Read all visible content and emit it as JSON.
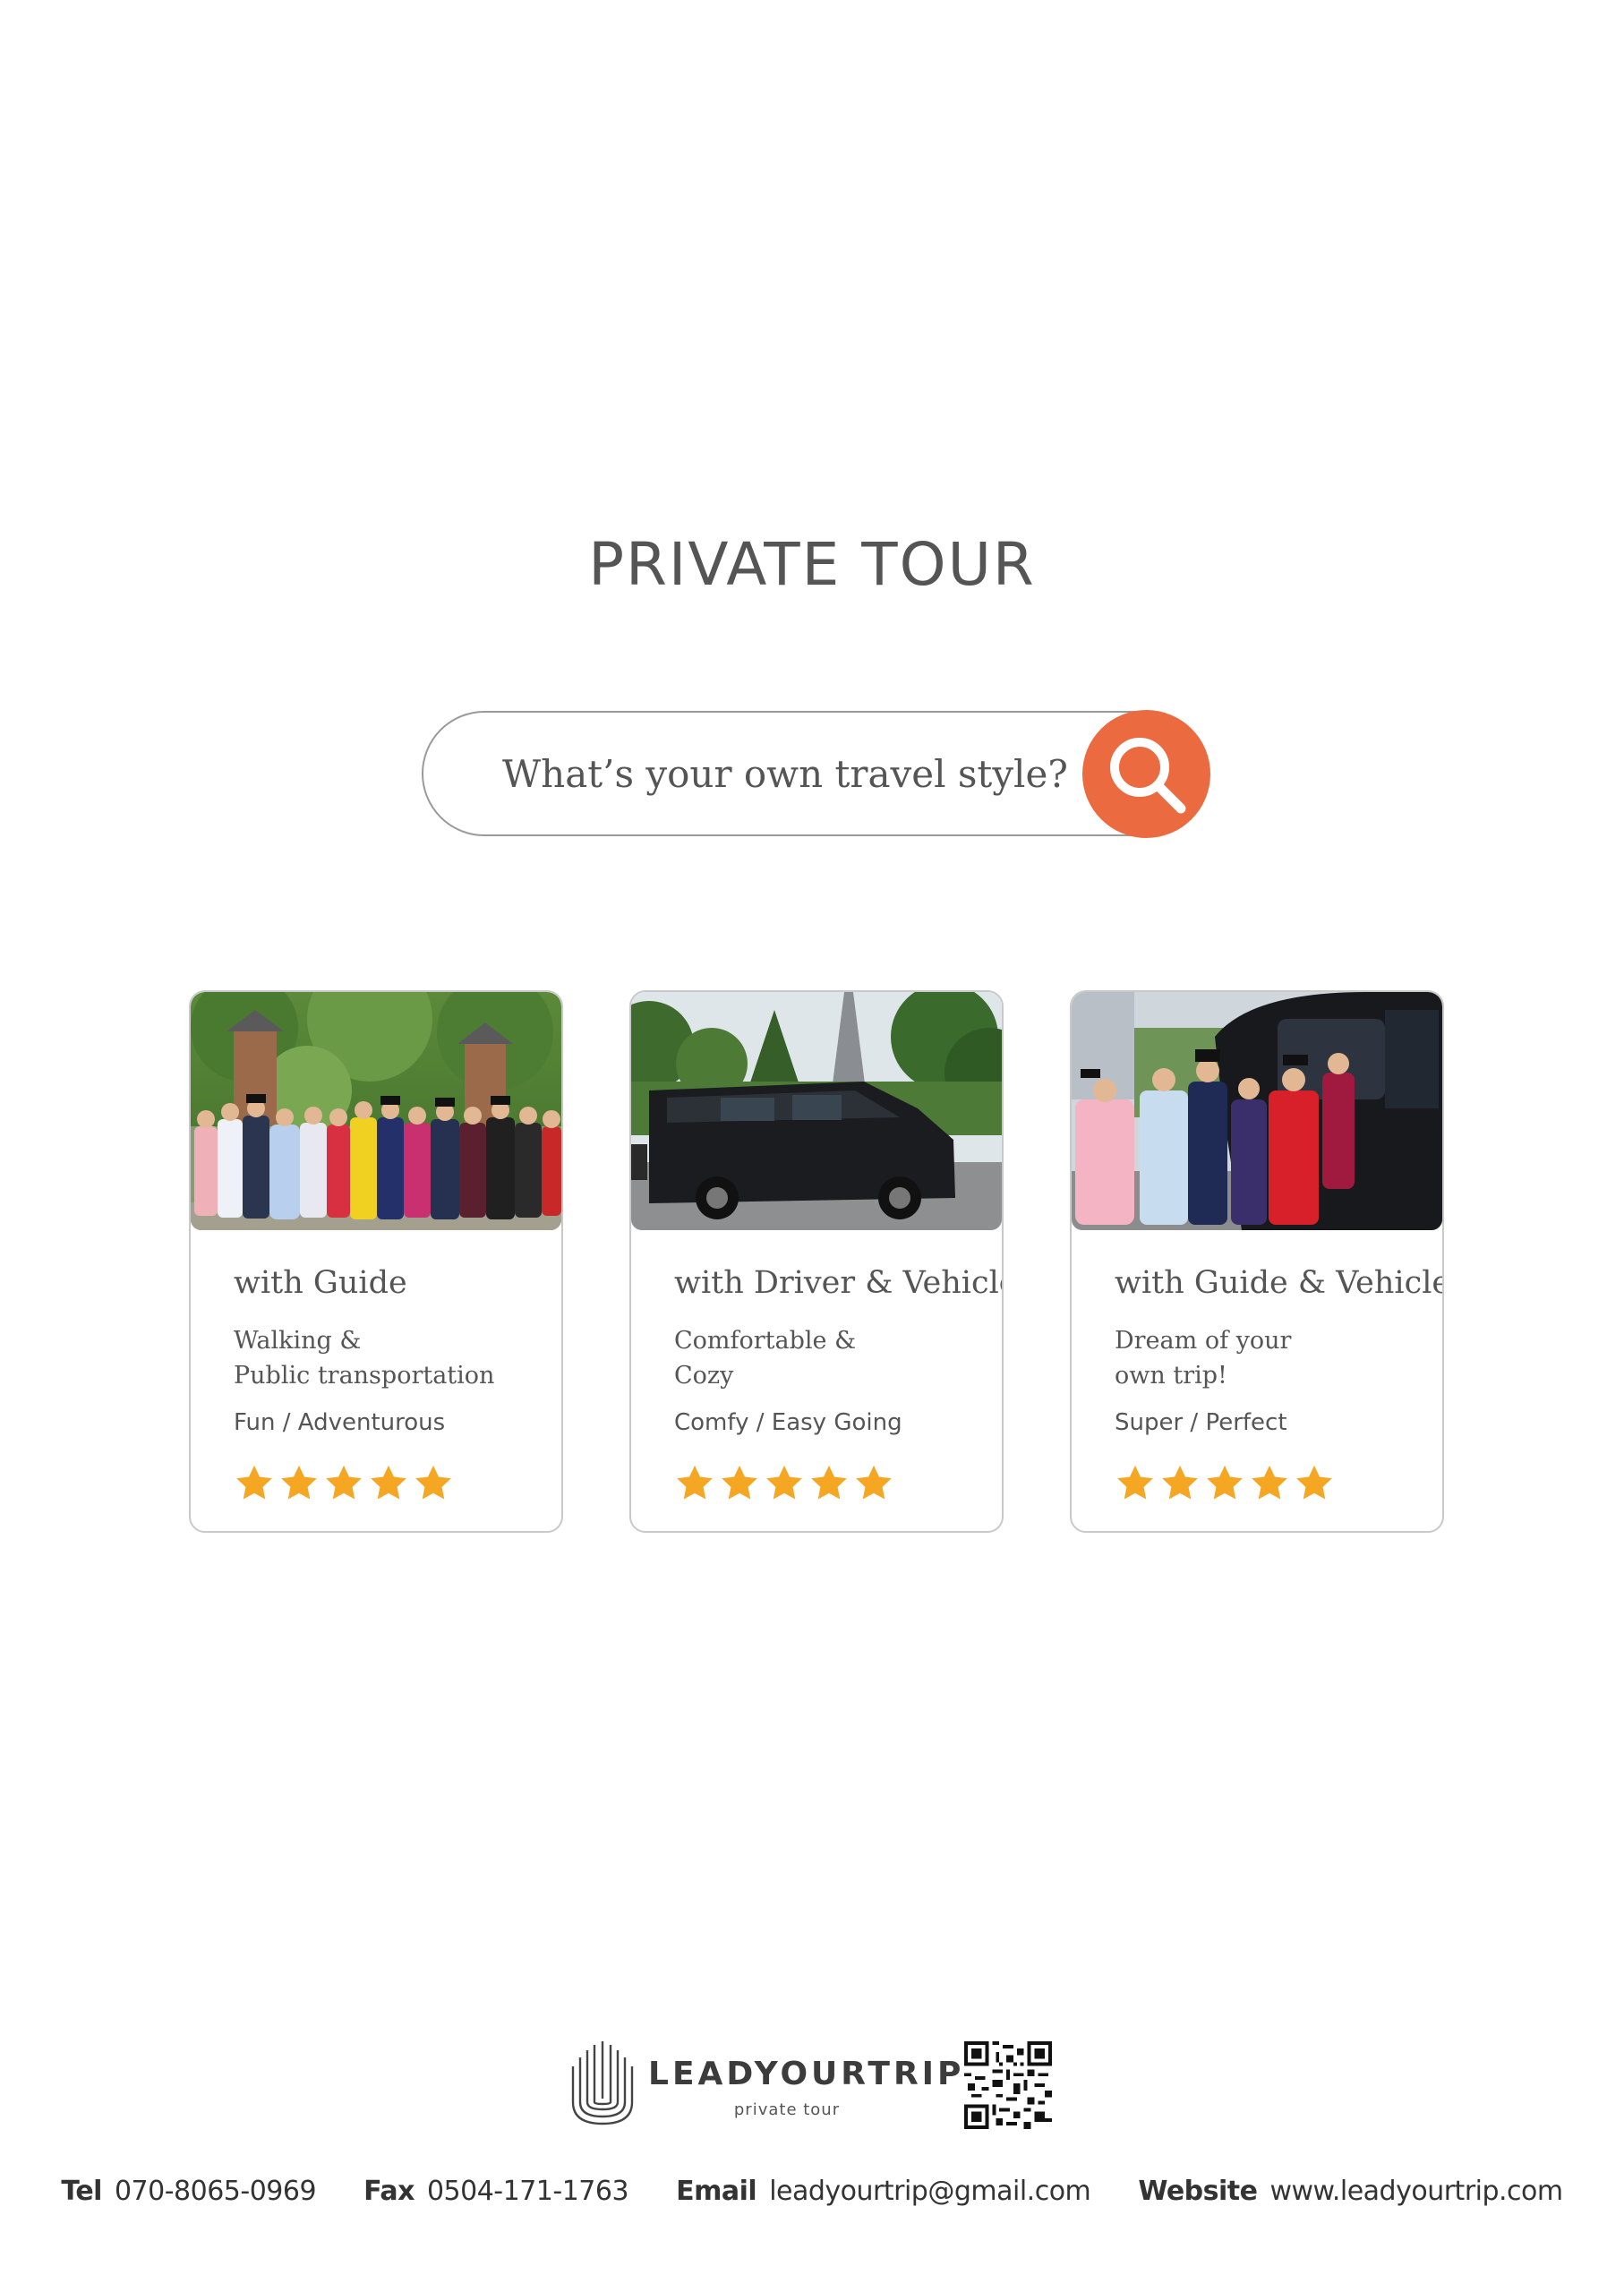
{
  "title": "PRIVATE TOUR",
  "search": {
    "placeholder": "What’s your own travel style?",
    "icon": "search-icon",
    "button_color": "#ec6a3f"
  },
  "cards": [
    {
      "title": "with Guide",
      "desc": "Walking &\nPublic transportation",
      "tagline": "Fun / Adventurous",
      "rating": 5,
      "photo": "group-in-hanbok-photo"
    },
    {
      "title": "with Driver & Vehicle",
      "desc": "Comfortable &\nCozy",
      "tagline": "Comfy / Easy Going",
      "rating": 5,
      "photo": "black-van-photo"
    },
    {
      "title": "with Guide & Vehicle",
      "desc": "Dream of your\nown trip!",
      "tagline": "Super / Perfect",
      "rating": 5,
      "photo": "group-boarding-van-photo"
    }
  ],
  "brand": {
    "name": "LEADYOURTRIP",
    "tagline": "private tour"
  },
  "contact": {
    "tel_label": "Tel",
    "tel": "070-8065-0969",
    "fax_label": "Fax",
    "fax": "0504-171-1763",
    "email_label": "Email",
    "email": "leadyourtrip@gmail.com",
    "website_label": "Website",
    "website": "www.leadyourtrip.com"
  },
  "colors": {
    "accent": "#ec6a3f",
    "star": "#f5a623",
    "text": "#555555"
  }
}
